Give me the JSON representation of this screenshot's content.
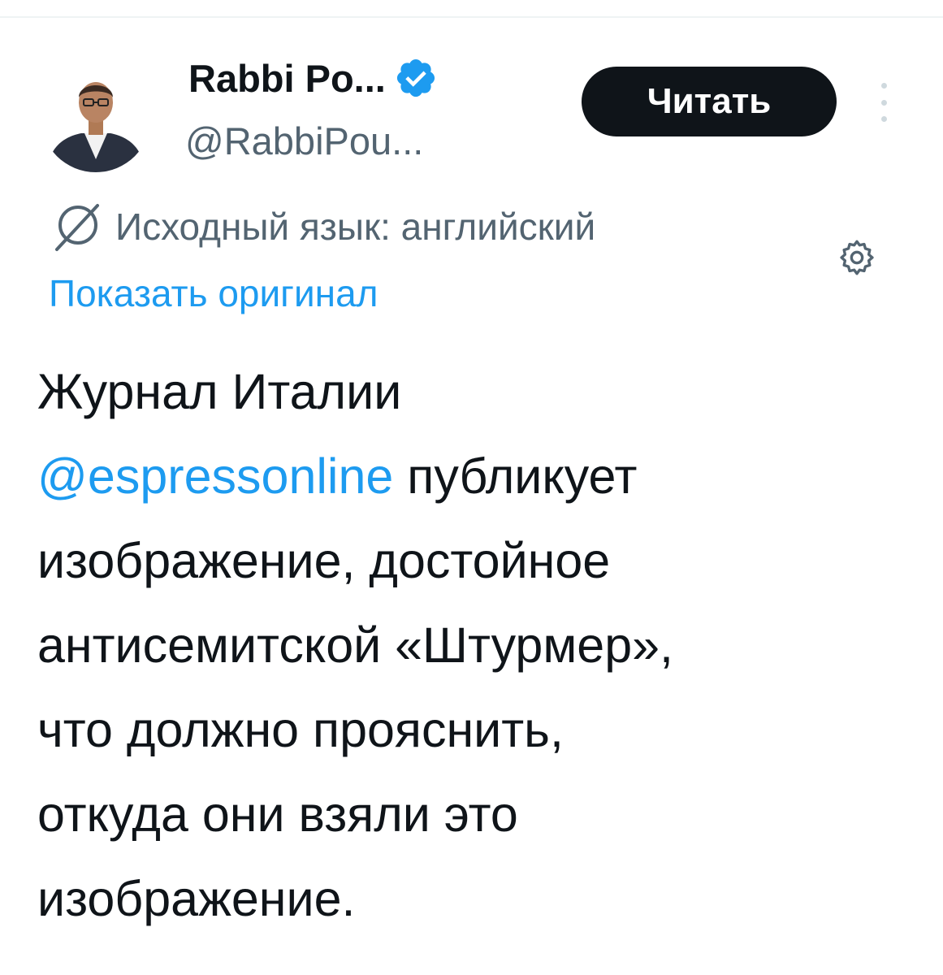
{
  "author": {
    "display_name": "Rabbi Po...",
    "handle": "@RabbiPou...",
    "verified_icon": "verified-badge-icon",
    "avatar_icon": "avatar-photo"
  },
  "actions": {
    "follow_label": "Читать",
    "more_icon": "more-vertical-icon"
  },
  "translation": {
    "icon": "translate-icon",
    "source_language": "Исходный язык: английский",
    "settings_icon": "gear-icon",
    "show_original_label": "Показать оригинал"
  },
  "tweet": {
    "lines": [
      "Журнал Италии",
      "публикует",
      "изображение, достойное",
      "антисемитской «Штурмер»,",
      "что должно прояснить,",
      "откуда они взяли это",
      "изображение."
    ],
    "mention": "@espressonline"
  },
  "colors": {
    "link": "#1d9bf0",
    "secondary_text": "#536471",
    "primary_text": "#0f1419",
    "button_bg": "#0f1419",
    "verified": "#1d9bf0"
  }
}
